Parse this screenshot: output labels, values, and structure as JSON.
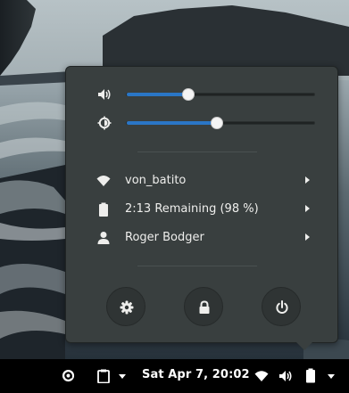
{
  "wallpaper": {
    "description_icon": "coastal-landscape"
  },
  "menu": {
    "volume": {
      "icon": "volume-icon",
      "level": 0.33
    },
    "brightness": {
      "icon": "brightness-icon",
      "level": 0.48
    },
    "items": [
      {
        "icon": "wifi-icon",
        "label": "von_batito"
      },
      {
        "icon": "battery-icon",
        "label": "2:13 Remaining (98 %)"
      },
      {
        "icon": "user-icon",
        "label": "Roger Bodger"
      }
    ],
    "buttons": [
      {
        "icon": "settings-icon"
      },
      {
        "icon": "lock-icon"
      },
      {
        "icon": "power-icon"
      }
    ]
  },
  "topbar": {
    "clock": "Sat Apr  7, 20:02",
    "left_icons": [
      "at-sign-icon",
      "clipboard-icon"
    ],
    "status_icons": [
      "wifi-icon",
      "volume-icon",
      "battery-icon"
    ]
  },
  "colors": {
    "accent": "#2a76c6",
    "menu_bg": "#393f3f",
    "bar_bg": "#000000"
  }
}
